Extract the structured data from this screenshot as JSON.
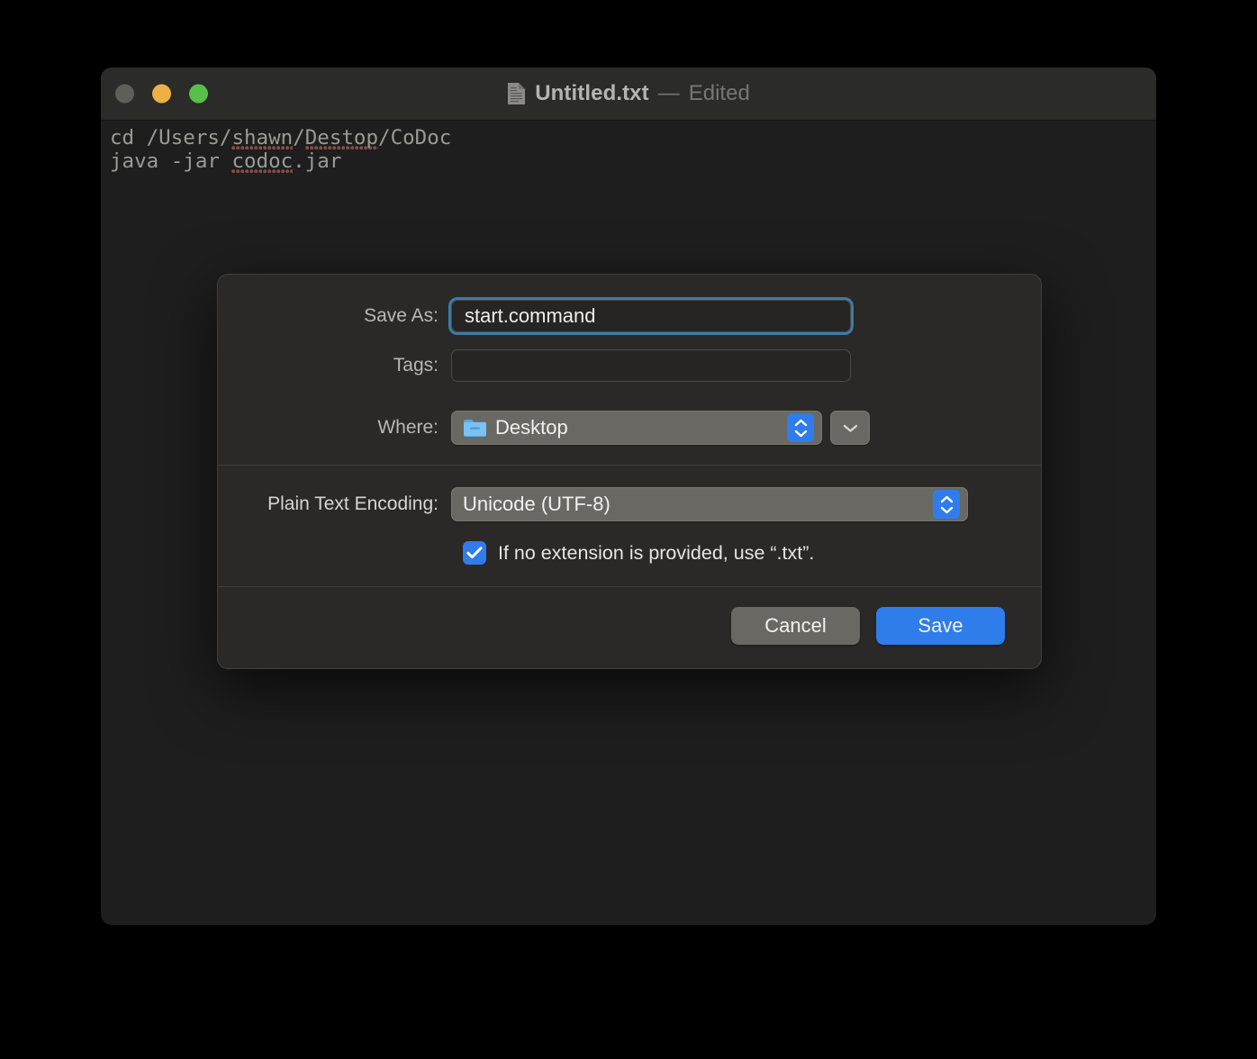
{
  "window": {
    "traffic_lights": [
      {
        "name": "close",
        "color": "#5f5f5a"
      },
      {
        "name": "minimize",
        "color": "#ecb043"
      },
      {
        "name": "maximize",
        "color": "#58c04a"
      }
    ],
    "title": {
      "icon": "document-icon",
      "filename": "Untitled.txt",
      "separator": "—",
      "status": "Edited"
    },
    "document": {
      "lines": [
        {
          "pre": "cd /Users/",
          "mis1": "shawn",
          "mid": "/",
          "mis2": "Destop",
          "post": "/CoDoc"
        },
        {
          "pre": "java -jar ",
          "mis1": "codoc",
          "mid": "",
          "mis2": "",
          "post": ".jar"
        }
      ],
      "line1_full": "cd /Users/shawn/Destop/CoDoc",
      "line2_full": "java -jar codoc.jar"
    }
  },
  "save_dialog": {
    "save_as": {
      "label": "Save As:",
      "value": "start.command",
      "placeholder": ""
    },
    "tags": {
      "label": "Tags:",
      "value": "",
      "placeholder": ""
    },
    "where": {
      "label": "Where:",
      "value": "Desktop",
      "icon": "folder-icon",
      "stepper_icon": "stepper-updown-icon",
      "expand_icon": "chevron-down-icon"
    },
    "encoding": {
      "label": "Plain Text Encoding:",
      "value": "Unicode (UTF-8)",
      "stepper_icon": "stepper-updown-icon"
    },
    "extension_checkbox": {
      "checked": true,
      "label": "If no extension is provided, use “.txt”."
    },
    "buttons": {
      "cancel": "Cancel",
      "save": "Save"
    },
    "colors": {
      "accent_blue": "#307cec",
      "focus_ring": "#3d7ba8",
      "control_gray": "#6a6862",
      "sheet_bg": "#2a2927"
    }
  }
}
